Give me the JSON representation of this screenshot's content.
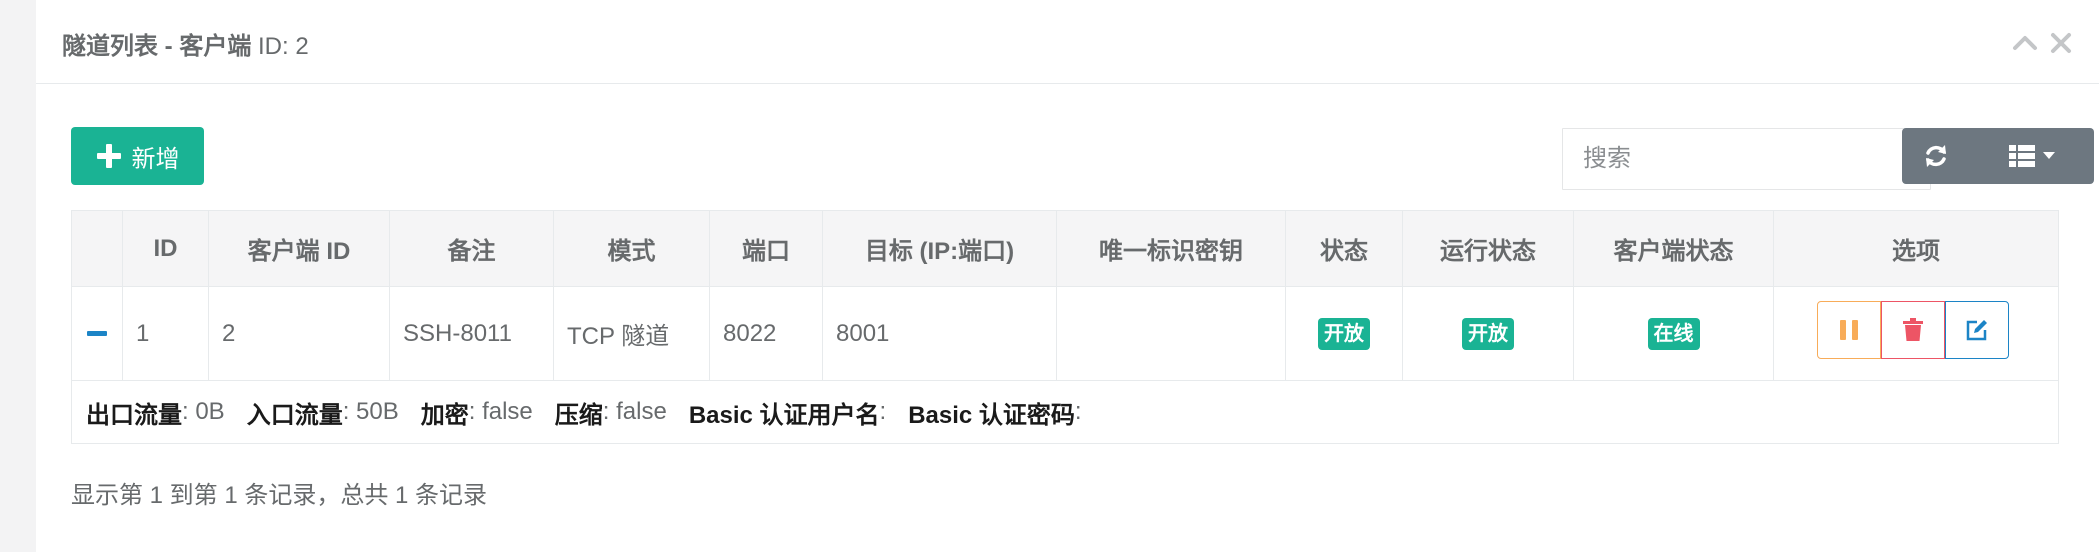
{
  "panel": {
    "title_prefix": "隧道列表 - 客户端",
    "title_id": " ID: 2"
  },
  "toolbar": {
    "add_label": "新增",
    "search_placeholder": "搜索",
    "refresh_icon": "refresh-icon",
    "columns_icon": "columns-icon"
  },
  "table": {
    "headers": [
      "",
      "ID",
      "客户端 ID",
      "备注",
      "模式",
      "端口",
      "目标 (IP:端口)",
      "唯一标识密钥",
      "状态",
      "运行状态",
      "客户端状态",
      "选项"
    ],
    "rows": [
      {
        "id": "1",
        "client_id": "2",
        "remark": "SSH-8011",
        "mode": "TCP 隧道",
        "port": "8022",
        "target": "8001",
        "key": "",
        "status": "开放",
        "run_status": "开放",
        "client_status": "在线",
        "detail": {
          "out_label": "出口流量",
          "out_value": ": 0B",
          "in_label": "入口流量",
          "in_value": ": 50B",
          "crypt_label": "加密",
          "crypt_value": ": false",
          "compress_label": "压缩",
          "compress_value": ": false",
          "basic_user_label": "Basic 认证用户名",
          "basic_user_value": ":",
          "basic_pass_label": "Basic 认证密码",
          "basic_pass_value": ":"
        }
      }
    ]
  },
  "pagination": {
    "info": "显示第 1 到第 1 条记录，总共 1 条记录"
  },
  "colors": {
    "primary": "#1ab394",
    "warning": "#f8ac59",
    "danger": "#ed5565",
    "info": "#1c84c6",
    "toolbar_gray": "#6d7780",
    "expand_blue": "#1c84c6"
  }
}
